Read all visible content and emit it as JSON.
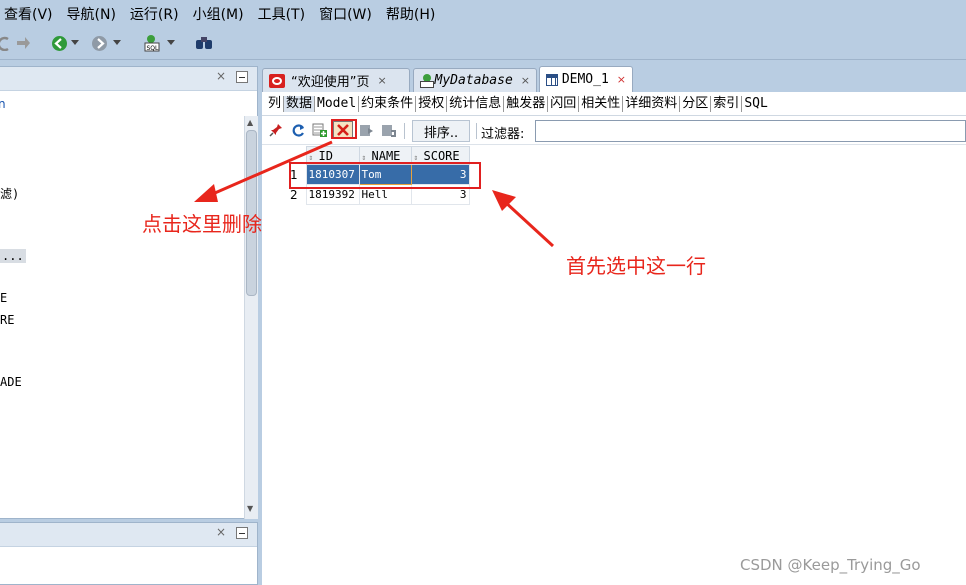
{
  "menu": [
    "查看(V)",
    "导航(N)",
    "运行(R)",
    "小组(M)",
    "工具(T)",
    "窗口(W)",
    "帮助(H)"
  ],
  "left_panel": {
    "lines": [
      "滤)",
      "...",
      "E",
      "RE",
      "ADE"
    ]
  },
  "tabs": [
    {
      "label": "“欢迎使用”页",
      "close": "×"
    },
    {
      "label": "MyDatabase",
      "close": "×"
    },
    {
      "label": "DEMO_1",
      "close": "×"
    }
  ],
  "subtabs": [
    "列",
    "数据",
    "Model",
    "约束条件",
    "授权",
    "统计信息",
    "触发器",
    "闪回",
    "相关性",
    "详细资料",
    "分区",
    "索引",
    "SQL"
  ],
  "gridbar": {
    "sort_label": "排序..",
    "filter_label": "过滤器:",
    "filter_value": ""
  },
  "grid": {
    "columns": [
      "ID",
      "NAME",
      "SCORE"
    ],
    "rows": [
      {
        "num": "1",
        "id": "1810307",
        "name": "Tom",
        "score": "3"
      },
      {
        "num": "2",
        "id": "1819392",
        "name": "Hell",
        "score": "3"
      }
    ]
  },
  "annotations": {
    "delete_hint": "点击这里删除",
    "select_hint": "首先选中这一行"
  },
  "watermark": "CSDN @Keep_Trying_Go",
  "colors": {
    "chrome": "#b9cde2",
    "selection": "#376ca8",
    "annotation": "#e8261c"
  }
}
